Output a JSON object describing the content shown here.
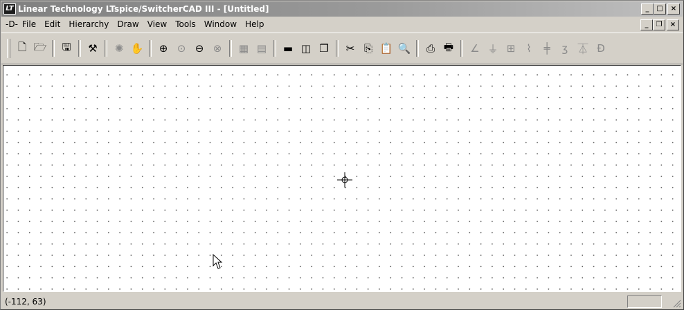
{
  "window": {
    "title": "Linear Technology LTspice/SwitcherCAD III - [Untitled]",
    "app_icon": "LT"
  },
  "title_buttons": {
    "minimize": "_",
    "maximize": "□",
    "close": "×"
  },
  "menubar": {
    "doc_icon": "-D-",
    "items": [
      {
        "label": "File"
      },
      {
        "label": "Edit"
      },
      {
        "label": "Hierarchy"
      },
      {
        "label": "Draw"
      },
      {
        "label": "View"
      },
      {
        "label": "Tools"
      },
      {
        "label": "Window"
      },
      {
        "label": "Help"
      }
    ]
  },
  "mdi_buttons": {
    "minimize": "_",
    "restore": "❐",
    "close": "×"
  },
  "toolbar": {
    "buttons": [
      {
        "icon": "new-schematic-icon",
        "glyph": "🗋"
      },
      {
        "icon": "open-icon",
        "glyph": "🗁"
      },
      {
        "icon": "save-icon",
        "glyph": "🖫"
      },
      {
        "icon": "control-panel-icon",
        "glyph": "⚒"
      },
      {
        "icon": "run-icon",
        "glyph": "✺"
      },
      {
        "icon": "pan-icon",
        "glyph": "✋"
      },
      {
        "icon": "zoom-in-icon",
        "glyph": "⊕"
      },
      {
        "icon": "zoom-area-icon",
        "glyph": "⊙"
      },
      {
        "icon": "zoom-out-icon",
        "glyph": "⊖"
      },
      {
        "icon": "zoom-fit-icon",
        "glyph": "⊗"
      },
      {
        "icon": "autorange-icon",
        "glyph": "▦"
      },
      {
        "icon": "grid-icon",
        "glyph": "▤"
      },
      {
        "icon": "tile-horizontal-icon",
        "glyph": "▬"
      },
      {
        "icon": "tile-vertical-icon",
        "glyph": "◫"
      },
      {
        "icon": "cascade-icon",
        "glyph": "❐"
      },
      {
        "icon": "cut-icon",
        "glyph": "✂"
      },
      {
        "icon": "copy-icon",
        "glyph": "⎘"
      },
      {
        "icon": "paste-icon",
        "glyph": "📋"
      },
      {
        "icon": "find-icon",
        "glyph": "🔍"
      },
      {
        "icon": "print-preview-icon",
        "glyph": "⎙"
      },
      {
        "icon": "print-icon",
        "glyph": "🖶"
      },
      {
        "icon": "wire-icon",
        "glyph": "∠"
      },
      {
        "icon": "ground-icon",
        "glyph": "⏚"
      },
      {
        "icon": "label-icon",
        "glyph": "⊞"
      },
      {
        "icon": "resistor-icon",
        "glyph": "⌇"
      },
      {
        "icon": "capacitor-icon",
        "glyph": "╪"
      },
      {
        "icon": "inductor-icon",
        "glyph": "ʒ"
      },
      {
        "icon": "diode-icon",
        "glyph": "⏄"
      },
      {
        "icon": "component-icon",
        "glyph": "Ð"
      }
    ]
  },
  "statusbar": {
    "coords": "(-112, 63)"
  },
  "colors": {
    "titlebar_start": "#808080",
    "titlebar_end": "#c0c0c0",
    "face": "#d4d0c8",
    "canvas": "#ffffff"
  }
}
